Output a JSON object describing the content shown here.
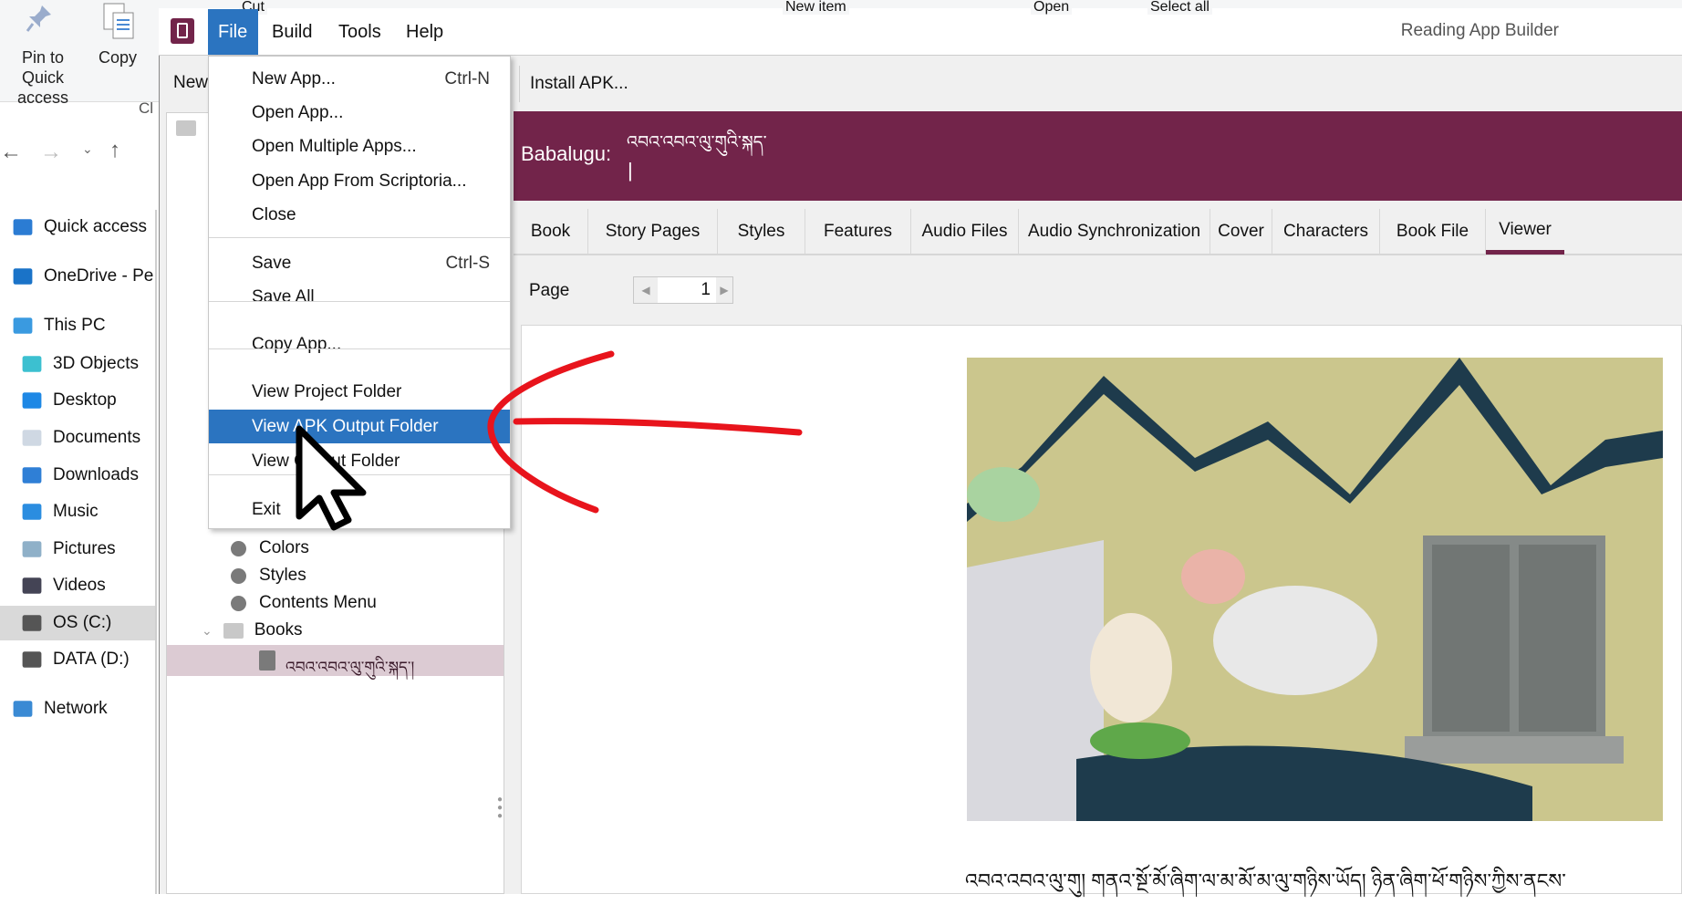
{
  "explorer": {
    "ribbon": {
      "pin_label": "Pin to Quick access",
      "copy_label": "Copy",
      "clipboard_label": "Cl",
      "cut_label": "Cut",
      "new_item_label": "New item",
      "open_label": "Open",
      "select_all_label": "Select all"
    },
    "nav_items": [
      {
        "label": "Quick access",
        "icon": "quick-access-star-icon"
      },
      {
        "label": "OneDrive - Pe",
        "icon": "onedrive-cloud-icon"
      },
      {
        "label": "This PC",
        "icon": "computer-icon"
      },
      {
        "label": "3D Objects",
        "icon": "3d-objects-icon"
      },
      {
        "label": "Desktop",
        "icon": "desktop-icon"
      },
      {
        "label": "Documents",
        "icon": "documents-icon"
      },
      {
        "label": "Downloads",
        "icon": "downloads-icon"
      },
      {
        "label": "Music",
        "icon": "music-icon"
      },
      {
        "label": "Pictures",
        "icon": "pictures-icon"
      },
      {
        "label": "Videos",
        "icon": "videos-icon"
      },
      {
        "label": "OS (C:)",
        "icon": "drive-icon"
      },
      {
        "label": "DATA (D:)",
        "icon": "drive-icon"
      },
      {
        "label": "Network",
        "icon": "network-icon"
      }
    ]
  },
  "app": {
    "title": "Reading App Builder",
    "menu": [
      "File",
      "Build",
      "Tools",
      "Help"
    ],
    "file_menu": [
      {
        "label": "New App...",
        "shortcut": "Ctrl-N"
      },
      {
        "label": "Open App..."
      },
      {
        "label": "Open Multiple Apps..."
      },
      {
        "label": "Open App From Scriptoria..."
      },
      {
        "label": "Close"
      },
      {
        "label": "Save",
        "shortcut": "Ctrl-S"
      },
      {
        "label": "Save All"
      },
      {
        "label": "Copy App..."
      },
      {
        "label": "View Project Folder"
      },
      {
        "label": "View APK Output Folder"
      },
      {
        "label": "View Output Folder"
      },
      {
        "label": "Exit"
      }
    ],
    "toolbar": {
      "new_label": "New",
      "install_apk_label": "Install APK..."
    },
    "tree": {
      "items": [
        "Colors",
        "Styles",
        "Contents Menu",
        "Books"
      ],
      "book": "འབའ་འབའ་ལུ་གུའི་སྐད་།"
    },
    "banner": {
      "label": "Babalugu:",
      "book_title": "འབའ་འབའ་ལུ་གུའི་སྐད་",
      "cursor": "|"
    },
    "tabs": [
      "Book",
      "Story Pages",
      "Styles",
      "Features",
      "Audio Files",
      "Audio Synchronization",
      "Cover",
      "Characters",
      "Book File",
      "Viewer"
    ],
    "active_tab": "Viewer",
    "viewer": {
      "page_label": "Page",
      "page_value": "1",
      "story_text": "འབའ་འབའ་ལུ་གུ། གནའ་སྔོ་མོ་ཞིག་ལ་མ་མོ་མ་ལུ་གཉིས་ཡོད། ཉིན་ཞིག་ཕོ་གཉིས་ཀྱིས་ནངས་"
    },
    "colors": {
      "accent": "#72244a",
      "menu_highlight": "#2b74c0",
      "annotation": "#e8141c"
    }
  }
}
